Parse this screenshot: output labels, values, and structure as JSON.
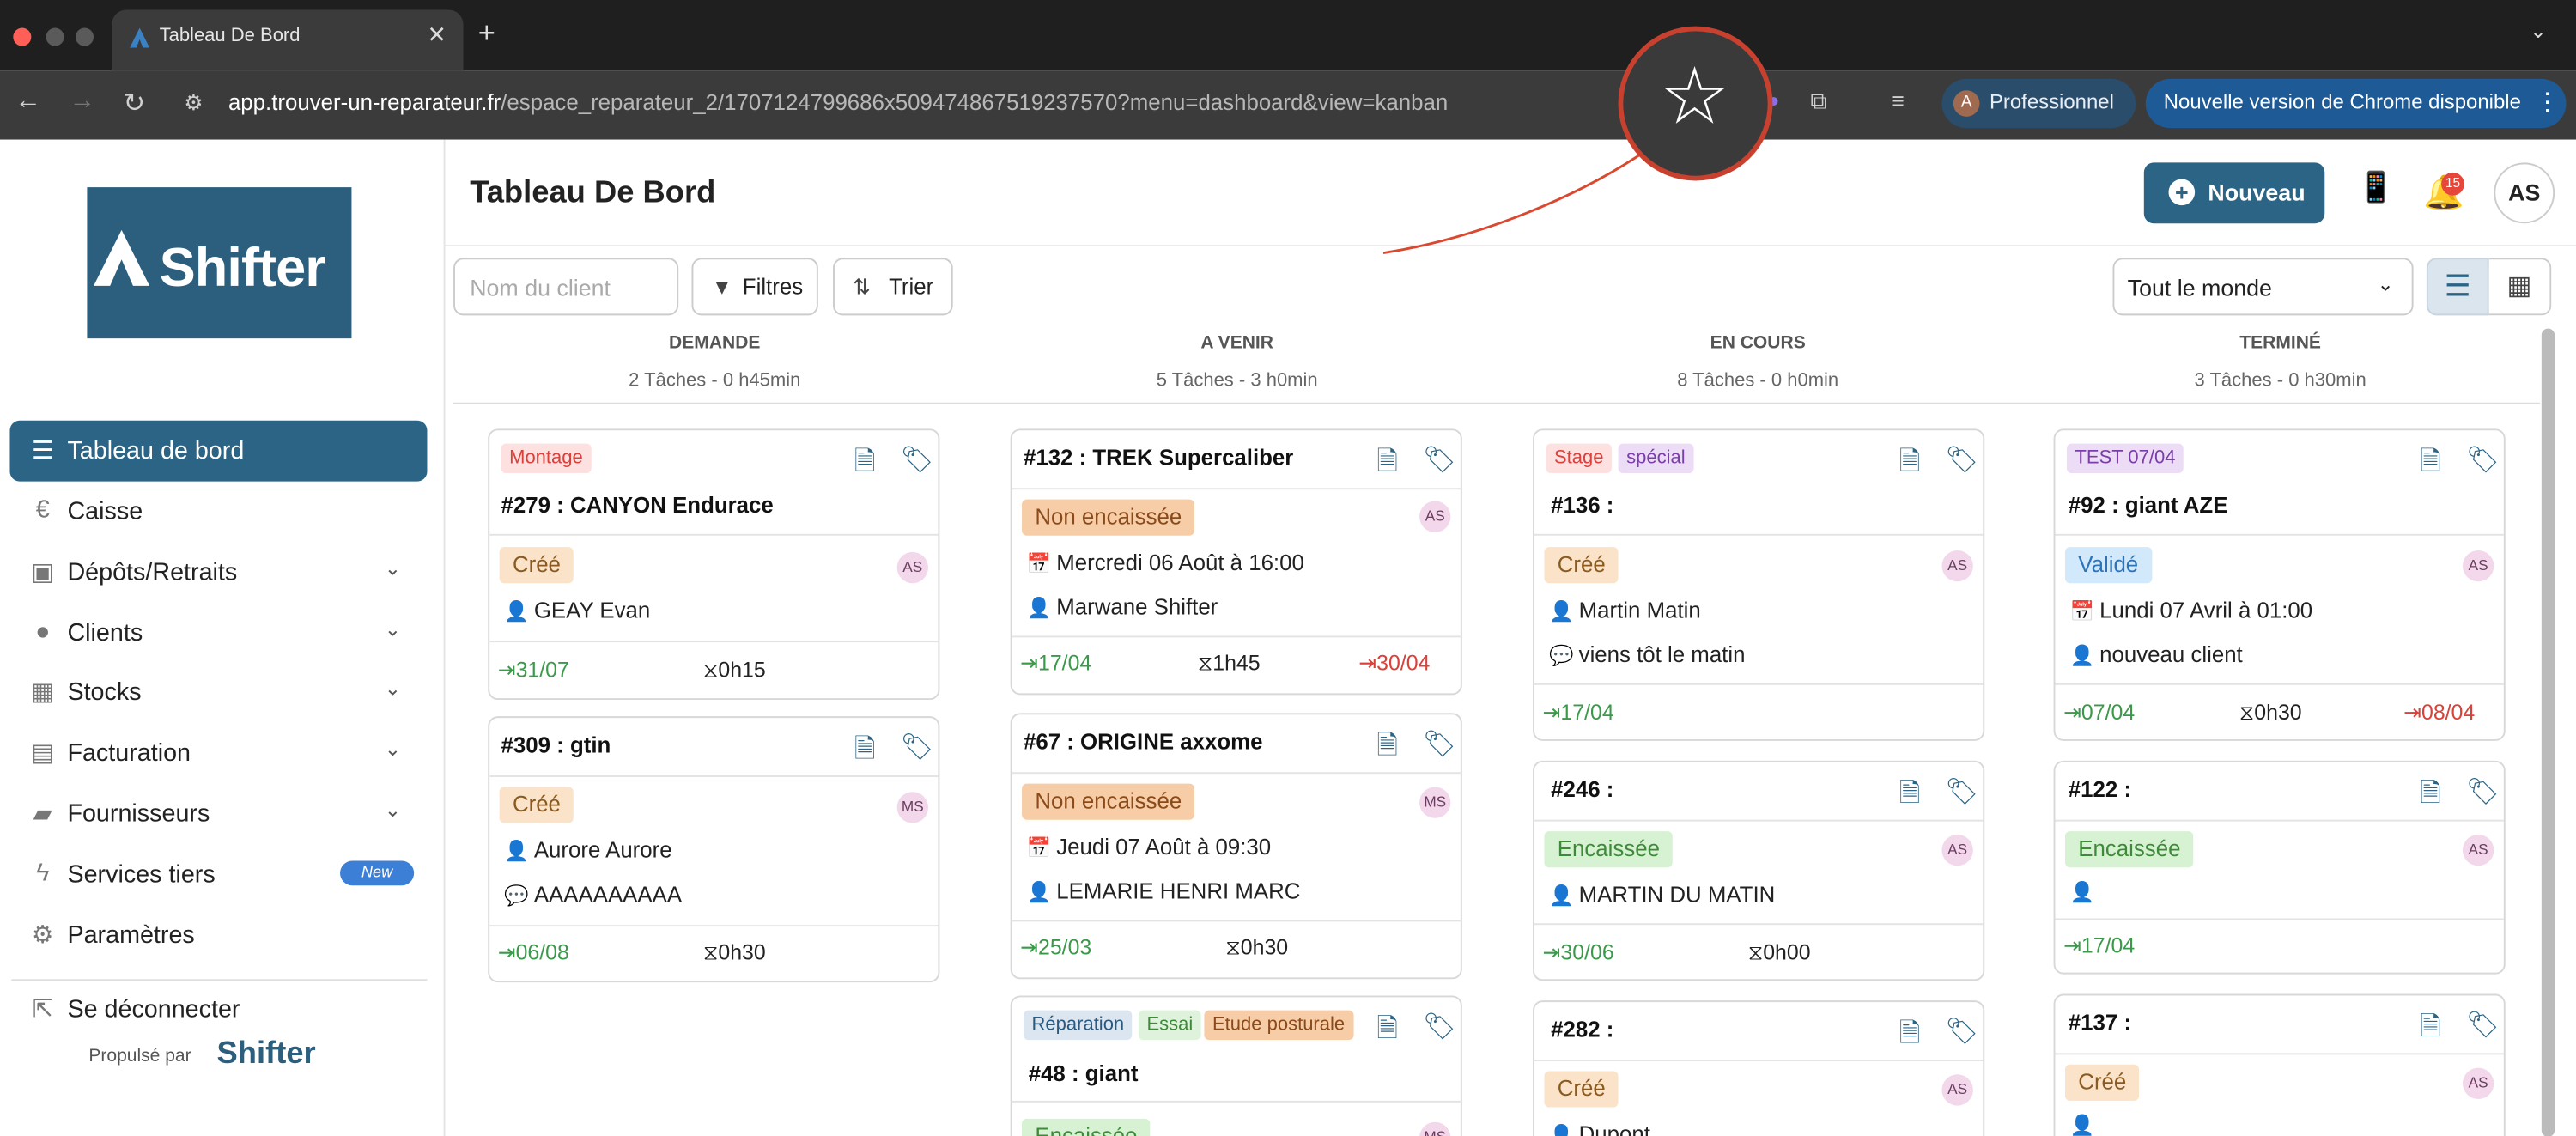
{
  "browser": {
    "tab_title": "Tableau De Bord",
    "url_host": "app.trouver-un-reparateur.fr",
    "url_path": "/espace_reparateur_2/1707124799686x509474867519237570?menu=dashboard&view=kanban",
    "profile_label": "Professionnel",
    "profile_initial": "A",
    "update_label": "Nouvelle version de Chrome disponible"
  },
  "sidebar": {
    "logo_text": "Shifter",
    "items": [
      {
        "label": "Tableau de bord",
        "icon": "list-icon"
      },
      {
        "label": "Caisse",
        "icon": "euro-icon"
      },
      {
        "label": "Dépôts/Retraits",
        "icon": "box-icon"
      },
      {
        "label": "Clients",
        "icon": "user-icon"
      },
      {
        "label": "Stocks",
        "icon": "cubes-icon"
      },
      {
        "label": "Facturation",
        "icon": "file-icon"
      },
      {
        "label": "Fournisseurs",
        "icon": "truck-icon"
      },
      {
        "label": "Services tiers",
        "icon": "bolt-icon",
        "badge": "New"
      },
      {
        "label": "Paramètres",
        "icon": "gear-icon"
      }
    ],
    "logout_label": "Se déconnecter",
    "powered_by": "Propulsé par",
    "powered_logo": "Shifter"
  },
  "header": {
    "title": "Tableau De Bord",
    "new_button": "Nouveau",
    "notif_count": "15",
    "avatar": "AS"
  },
  "filters": {
    "search_placeholder": "Nom du client",
    "filters_label": "Filtres",
    "sort_label": "Trier",
    "assignee_select": "Tout le monde"
  },
  "columns": [
    {
      "title": "DEMANDE",
      "summary": "2 Tâches - 0 h45min"
    },
    {
      "title": "A VENIR",
      "summary": "5 Tâches - 3 h0min"
    },
    {
      "title": "EN COURS",
      "summary": "8 Tâches - 0 h0min"
    },
    {
      "title": "TERMINÉ",
      "summary": "3 Tâches - 0 h30min"
    }
  ],
  "cards": {
    "c279": {
      "tags": [
        "Montage"
      ],
      "title": "#279 : CANYON  Endurace",
      "status": "Créé",
      "initials": "AS",
      "client": "GEAY Evan",
      "in": "31/07",
      "duration": "0h15"
    },
    "c309": {
      "title": "#309 :  gtin",
      "status": "Créé",
      "initials": "MS",
      "client": "Aurore Aurore",
      "comment": "AAAAAAAAAA",
      "in": "06/08",
      "duration": "0h30"
    },
    "c132": {
      "title": "#132 : TREK  Supercaliber",
      "status": "Non encaissée",
      "initials": "AS",
      "date": "Mercredi 06 Août à 16:00",
      "client": "Marwane Shifter",
      "in": "17/04",
      "duration": "1h45",
      "out": "30/04"
    },
    "c67": {
      "title": "#67 : ORIGINE  axxome",
      "status": "Non encaissée",
      "initials": "MS",
      "date": "Jeudi 07 Août à 09:30",
      "client": "LEMARIE HENRI MARC",
      "in": "25/03",
      "duration": "0h30"
    },
    "c48": {
      "tags": [
        "Réparation",
        "Essai",
        "Etude posturale"
      ],
      "title": "#48 : giant",
      "status": "Encaissée",
      "initials": "MS"
    },
    "c136": {
      "tags": [
        "Stage",
        "spécial"
      ],
      "title": "#136 :",
      "status": "Créé",
      "initials": "AS",
      "client": "Martin Matin",
      "comment": "viens tôt le matin",
      "in": "17/04"
    },
    "c246": {
      "title": "#246 :",
      "status": "Encaissée",
      "initials": "AS",
      "client": "MARTIN DU MATIN",
      "in": "30/06",
      "duration": "0h00"
    },
    "c282": {
      "title": "#282 :",
      "status": "Créé",
      "initials": "AS",
      "client": "Dupont"
    },
    "c92": {
      "tags": [
        "TEST 07/04"
      ],
      "title": "#92 : giant  AZE",
      "status": "Validé",
      "initials": "AS",
      "date": "Lundi 07 Avril à 01:00",
      "client": "nouveau client",
      "in": "07/04",
      "duration": "0h30",
      "out": "08/04"
    },
    "c122": {
      "title": "#122 :",
      "status": "Encaissée",
      "initials": "AS",
      "in": "17/04"
    },
    "c137": {
      "title": "#137 :",
      "status": "Créé",
      "initials": "AS"
    }
  },
  "colors": {
    "primary": "#2b6485",
    "danger": "#d9413a",
    "success": "#3a9a4a"
  }
}
